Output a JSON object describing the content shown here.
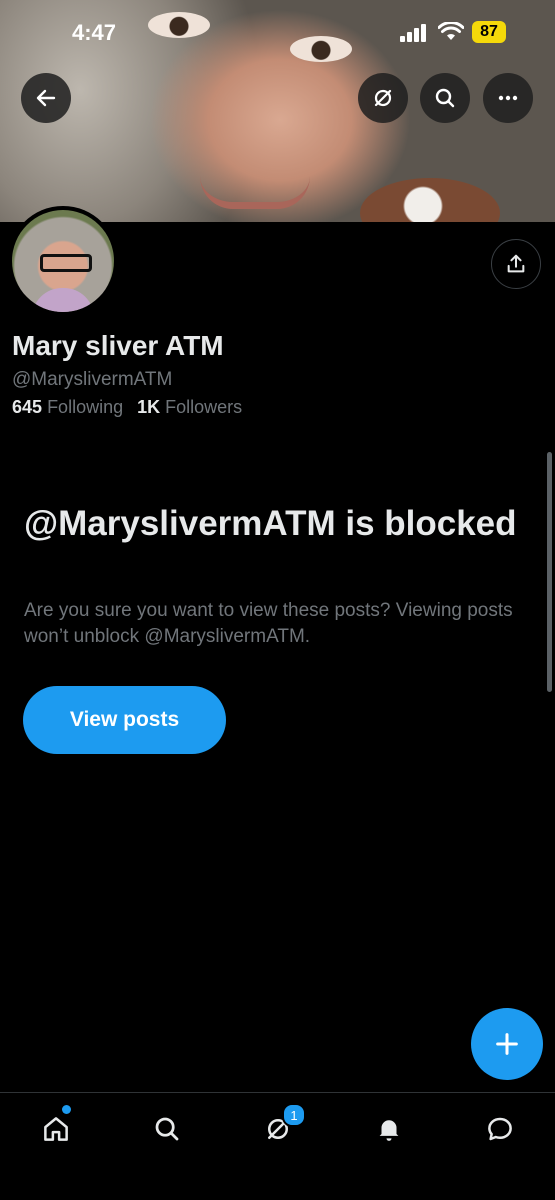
{
  "status_bar": {
    "time": "4:47",
    "battery": "87"
  },
  "profile": {
    "display_name": "Mary sliver ATM",
    "handle": "@MaryslivermATM",
    "following_count": "645",
    "following_label": "Following",
    "followers_count": "1K",
    "followers_label": "Followers"
  },
  "blocked": {
    "title": "@MaryslivermATM is blocked",
    "description": "Are you sure you want to view these posts? Viewing posts won’t unblock @MaryslivermATM.",
    "button_label": "View posts"
  },
  "tabs": {
    "spaces_badge": "1"
  },
  "colors": {
    "accent": "#1d9bf0",
    "background": "#000000",
    "primary_text": "#e7e9ea",
    "secondary_text": "#71767b",
    "battery": "#f5d90a"
  },
  "icons": {
    "back": "arrow-left-icon",
    "grok": "grok-icon",
    "search": "search-icon",
    "more": "more-horizontal-icon",
    "share": "share-icon",
    "compose": "plus-icon",
    "home": "home-icon",
    "explore": "search-icon",
    "grok_tab": "grok-icon",
    "notifications": "bell-icon",
    "messages": "chat-bubble-icon"
  }
}
